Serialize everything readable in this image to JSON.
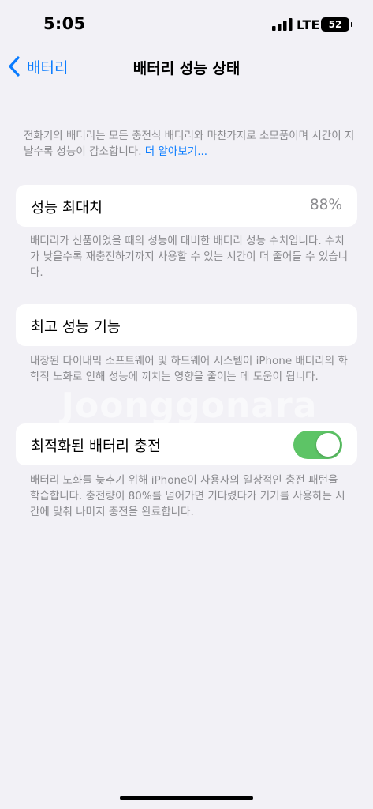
{
  "status_bar": {
    "time": "5:05",
    "network": "LTE",
    "battery_level": "52"
  },
  "nav": {
    "back_label": "배터리",
    "title": "배터리 성능 상태"
  },
  "intro": {
    "text": "전화기의 배터리는 모든 충전식 배터리와 마찬가지로 소모품이며 시간이 지날수록 성능이 감소합니다. ",
    "link": "더 알아보기..."
  },
  "maximum_capacity": {
    "label": "성능 최대치",
    "value": "88%",
    "footnote": "배터리가 신품이었을 때의 성능에 대비한 배터리 성능 수치입니다. 수치가 낮을수록 재충전하기까지 사용할 수 있는 시간이 더 줄어들 수 있습니다."
  },
  "peak_performance": {
    "label": "최고 성능 기능",
    "footnote": "내장된 다이내믹 소프트웨어 및 하드웨어 시스템이 iPhone 배터리의 화학적 노화로 인해 성능에 끼치는 영향을 줄이는 데 도움이 됩니다."
  },
  "optimized_charging": {
    "label": "최적화된 배터리 충전",
    "enabled": true,
    "footnote": "배터리 노화를 늦추기 위해 iPhone이 사용자의 일상적인 충전 패턴을 학습합니다. 충전량이 80%를 넘어가면 기다렸다가 기기를 사용하는 시간에 맞춰 나머지 충전을 완료합니다."
  },
  "watermark": "Joonggonara",
  "colors": {
    "accent": "#0a7cff",
    "toggle_on": "#5dc466",
    "background": "#f2f1f6"
  }
}
